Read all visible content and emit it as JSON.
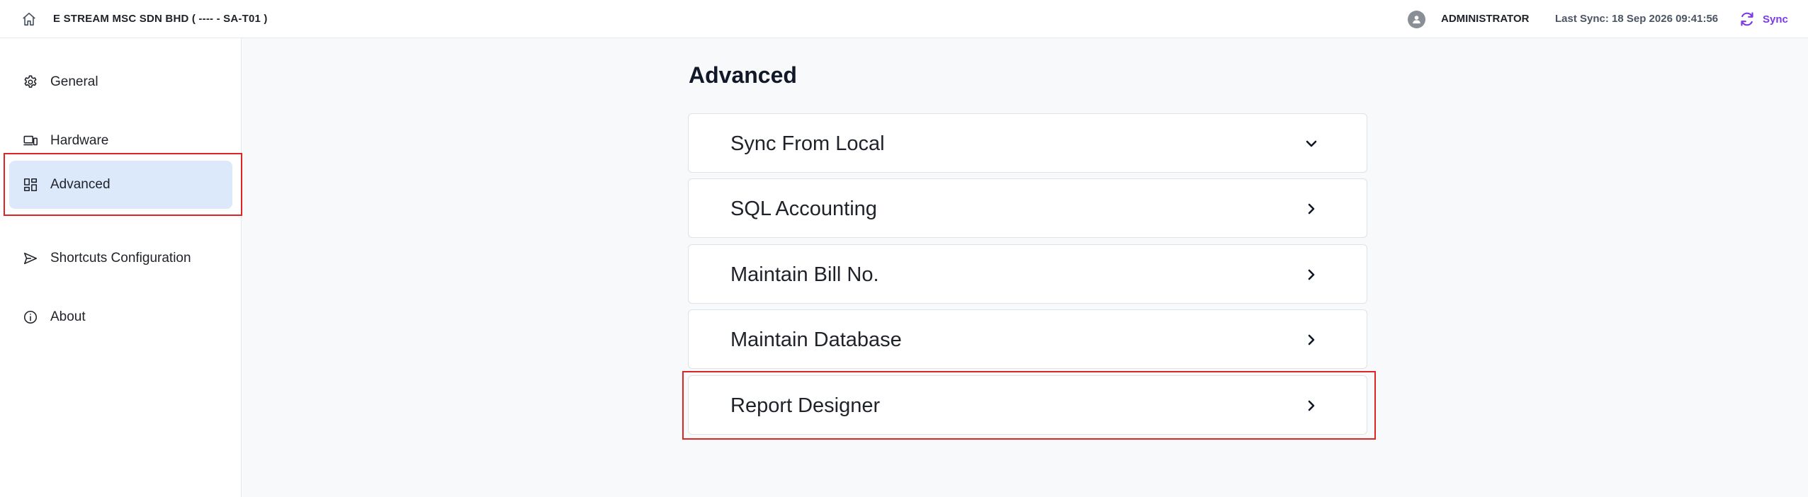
{
  "header": {
    "company": "E STREAM MSC SDN BHD ( ---- - SA-T01 )",
    "user": "ADMINISTRATOR",
    "last_sync": "Last Sync: 18 Sep 2026 09:41:56",
    "sync_label": "Sync",
    "accent_color": "#7c3aed"
  },
  "sidebar": {
    "items": [
      {
        "label": "General",
        "icon": "gear-icon"
      },
      {
        "label": "Hardware",
        "icon": "devices-icon"
      },
      {
        "label": "Advanced",
        "icon": "dashboard-icon",
        "active": true
      },
      {
        "label": "Shortcuts Configuration",
        "icon": "send-icon"
      },
      {
        "label": "About",
        "icon": "info-icon"
      }
    ]
  },
  "main": {
    "title": "Advanced",
    "sections": [
      {
        "label": "Sync From Local",
        "chevron": "chevron-down-icon"
      },
      {
        "label": "SQL Accounting",
        "chevron": "chevron-right-icon"
      },
      {
        "label": "Maintain Bill No.",
        "chevron": "chevron-right-icon"
      },
      {
        "label": "Maintain Database",
        "chevron": "chevron-right-icon"
      },
      {
        "label": "Report Designer",
        "chevron": "chevron-right-icon"
      }
    ]
  },
  "highlight_color": "#e02424"
}
